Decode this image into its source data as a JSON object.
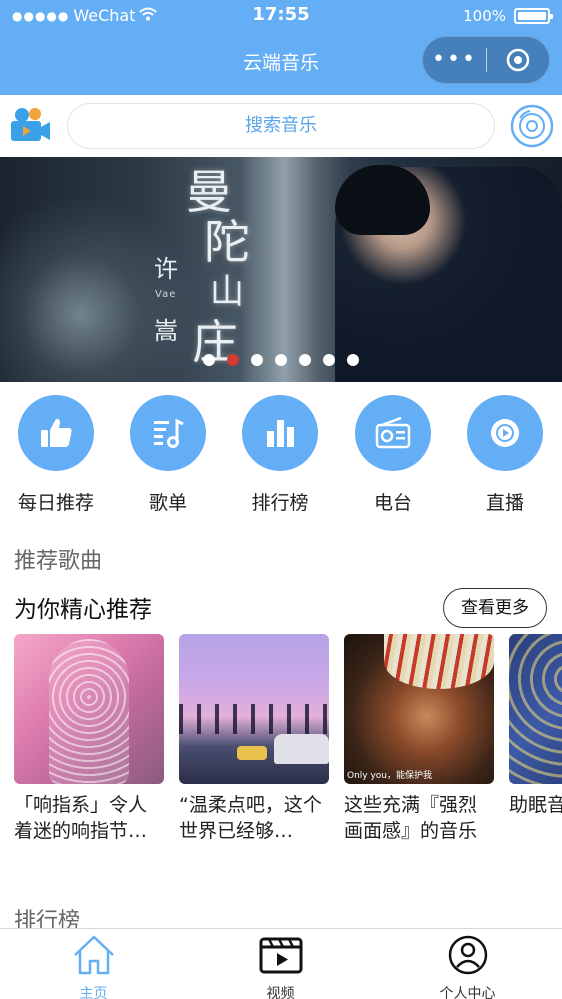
{
  "status_bar": {
    "signal": "●●●●●",
    "carrier": "WeChat",
    "time": "17:55",
    "battery": "100%"
  },
  "nav": {
    "title": "云端音乐",
    "more": "•••"
  },
  "search": {
    "placeholder": "搜索音乐",
    "icons": {
      "left": "video-camera-icon",
      "right": "music-disc-icon"
    }
  },
  "banner": {
    "calligraphy": [
      "曼",
      "陀",
      "山",
      "庄"
    ],
    "artist": [
      "许",
      "嵩"
    ],
    "artist_latin": "Vae",
    "dots_total": 7,
    "dots_active": 1
  },
  "categories": [
    {
      "label": "每日推荐",
      "icon": "thumbs-up-icon"
    },
    {
      "label": "歌单",
      "icon": "playlist-icon"
    },
    {
      "label": "排行榜",
      "icon": "bar-chart-icon"
    },
    {
      "label": "电台",
      "icon": "radio-icon"
    },
    {
      "label": "直播",
      "icon": "live-disc-icon"
    }
  ],
  "recommend": {
    "section_title": "推荐歌曲",
    "subtitle": "为你精心推荐",
    "more_label": "查看更多",
    "items": [
      {
        "name": "「响指系」令人着迷的响指节…"
      },
      {
        "name": "“温柔点吧，这个世界已经够…"
      },
      {
        "name": "这些充满『强烈画面感』的音乐",
        "caption": "Only you，能保护我"
      },
      {
        "name": "助眠音，"
      }
    ]
  },
  "ranking": {
    "section_title": "排行榜"
  },
  "tabbar": [
    {
      "label": "主页",
      "icon": "home-icon",
      "active": true
    },
    {
      "label": "视频",
      "icon": "clapperboard-icon",
      "active": false
    },
    {
      "label": "个人中心",
      "icon": "user-icon",
      "active": false
    }
  ],
  "colors": {
    "primary": "#64aef5",
    "banner_dot_active": "#d33a32",
    "text": "#222222",
    "section_gray": "#666666"
  }
}
